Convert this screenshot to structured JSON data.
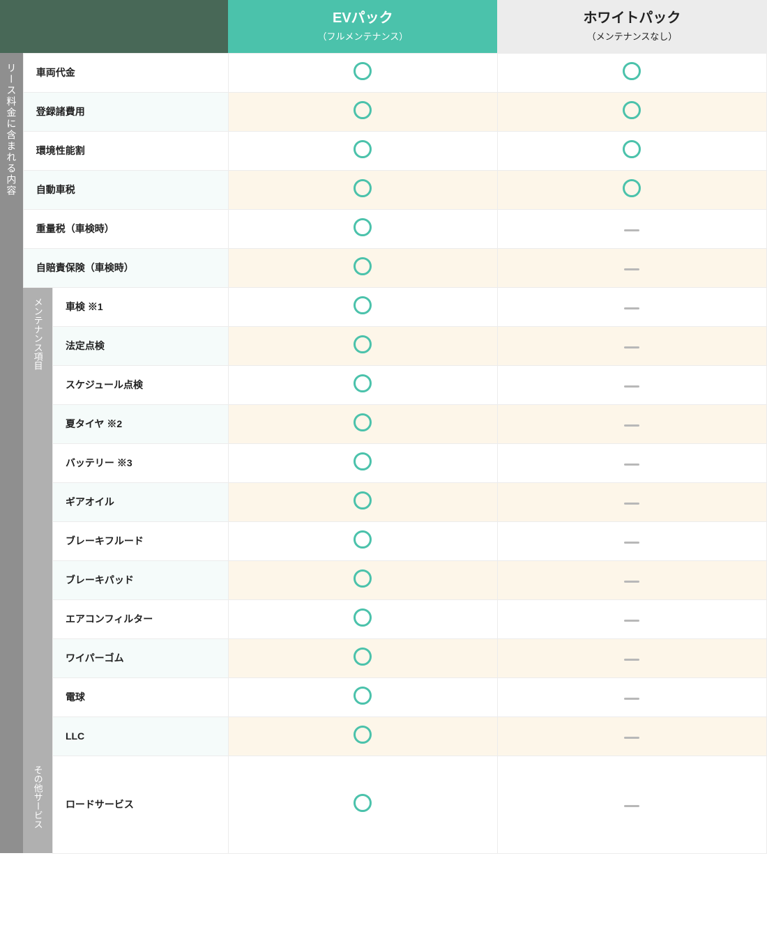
{
  "headers": {
    "ev": {
      "title": "EVパック",
      "sub": "（フルメンテナンス）"
    },
    "white": {
      "title": "ホワイトパック",
      "sub": "（メンテナンスなし）"
    }
  },
  "sections": {
    "main": "リース料金に含まれる内容",
    "maint": "メンテナンス項目",
    "other": "その他サービス"
  },
  "rows": {
    "vehicle": "車両代金",
    "register": "登録諸費用",
    "envtax": "環境性能割",
    "autotax": "自動車税",
    "weighttax": "重量税（車検時）",
    "liability": "自賠責保険（車検時）",
    "inspection": "車検 ※1",
    "legal": "法定点検",
    "schedule": "スケジュール点検",
    "tires": "夏タイヤ ※2",
    "battery": "バッテリー ※3",
    "gearoil": "ギアオイル",
    "brakefluid": "ブレーキフルード",
    "brakepad": "ブレーキパッド",
    "acfilter": "エアコンフィルター",
    "wiper": "ワイパーゴム",
    "bulb": "電球",
    "llc": "LLC",
    "roadside": "ロードサービス"
  },
  "values": {
    "vehicle": {
      "ev": "circle",
      "white": "circle"
    },
    "register": {
      "ev": "circle",
      "white": "circle"
    },
    "envtax": {
      "ev": "circle",
      "white": "circle"
    },
    "autotax": {
      "ev": "circle",
      "white": "circle"
    },
    "weighttax": {
      "ev": "circle",
      "white": "dash"
    },
    "liability": {
      "ev": "circle",
      "white": "dash"
    },
    "inspection": {
      "ev": "circle",
      "white": "dash"
    },
    "legal": {
      "ev": "circle",
      "white": "dash"
    },
    "schedule": {
      "ev": "circle",
      "white": "dash"
    },
    "tires": {
      "ev": "circle",
      "white": "dash"
    },
    "battery": {
      "ev": "circle",
      "white": "dash"
    },
    "gearoil": {
      "ev": "circle",
      "white": "dash"
    },
    "brakefluid": {
      "ev": "circle",
      "white": "dash"
    },
    "brakepad": {
      "ev": "circle",
      "white": "dash"
    },
    "acfilter": {
      "ev": "circle",
      "white": "dash"
    },
    "wiper": {
      "ev": "circle",
      "white": "dash"
    },
    "bulb": {
      "ev": "circle",
      "white": "dash"
    },
    "llc": {
      "ev": "circle",
      "white": "dash"
    },
    "roadside": {
      "ev": "circle",
      "white": "dash"
    }
  }
}
